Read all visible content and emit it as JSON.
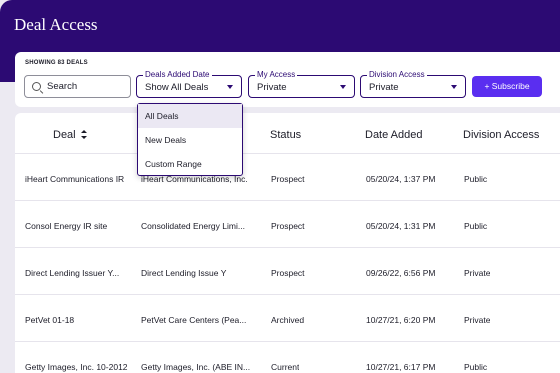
{
  "header": {
    "title": "Deal Access"
  },
  "filters": {
    "showing": "SHOWING 83 DEALS",
    "search_label": "Search",
    "deals_added_date": {
      "label": "Deals Added Date",
      "value": "Show All Deals"
    },
    "my_access": {
      "label": "My Access",
      "value": "Private"
    },
    "division_access": {
      "label": "Division Access",
      "value": "Private"
    },
    "subscribe_label": "+ Subscribe"
  },
  "dropdown": {
    "options": [
      "All Deals",
      "New Deals",
      "Custom Range"
    ]
  },
  "table": {
    "headers": {
      "deal": "Deal",
      "status": "Status",
      "date_added": "Date Added",
      "division_access": "Division Access"
    },
    "rows": [
      {
        "deal": "iHeart Communications IR",
        "company": "iHeart Communications, Inc.",
        "status": "Prospect",
        "date_added": "05/20/24, 1:37 PM",
        "division_access": "Public"
      },
      {
        "deal": "Consol Energy IR site",
        "company": "Consolidated Energy Limi...",
        "status": "Prospect",
        "date_added": "05/20/24, 1:31 PM",
        "division_access": "Public"
      },
      {
        "deal": "Direct Lending Issuer Y...",
        "company": "Direct Lending Issue Y",
        "status": "Prospect",
        "date_added": "09/26/22, 6:56 PM",
        "division_access": "Private"
      },
      {
        "deal": "PetVet 01-18",
        "company": "PetVet Care Centers (Pea...",
        "status": "Archived",
        "date_added": "10/27/21, 6:20 PM",
        "division_access": "Private"
      },
      {
        "deal": "Getty Images, Inc. 10-2012",
        "company": "Getty Images, Inc. (ABE IN...",
        "status": "Current",
        "date_added": "10/27/21, 6:17 PM",
        "division_access": "Public"
      }
    ]
  }
}
